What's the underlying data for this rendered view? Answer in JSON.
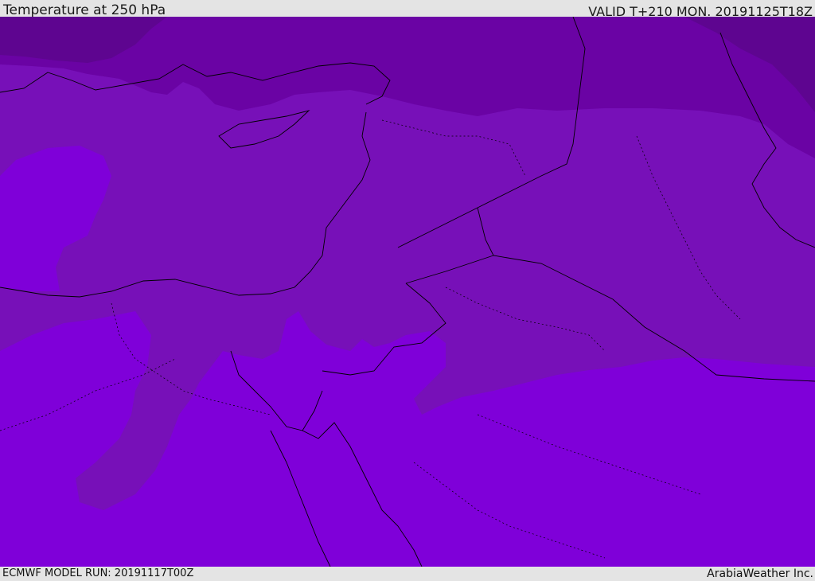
{
  "header": {
    "title": "Temperature at 250 hPa",
    "valid": "VALID T+210 MON. 20191125T18Z"
  },
  "footer": {
    "model_run": "ECMWF MODEL RUN: 20191117T00Z",
    "credit": "ArabiaWeather Inc."
  },
  "colors": {
    "band_coldest": "#5e0590",
    "band_cold": "#6a03a4",
    "band_mid": "#7710b8",
    "band_warm": "#7f00d9",
    "borders": "#000000"
  }
}
